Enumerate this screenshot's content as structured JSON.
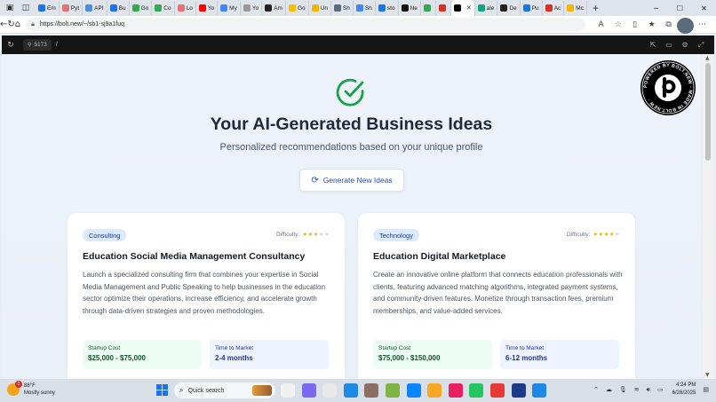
{
  "browser": {
    "tabs": [
      {
        "label": "Em",
        "color": "#1a73e8"
      },
      {
        "label": "Pyt",
        "color": "#e57373"
      },
      {
        "label": "API",
        "color": "#4a90d9"
      },
      {
        "label": "Bu",
        "color": "#1a73e8"
      },
      {
        "label": "Go",
        "color": "#34a853"
      },
      {
        "label": "Co",
        "color": "#34a853"
      },
      {
        "label": "Lo",
        "color": "#e57373"
      },
      {
        "label": "Yo",
        "color": "#ff0000"
      },
      {
        "label": "My",
        "color": "#4285f4"
      },
      {
        "label": "Yo",
        "color": "#999999"
      },
      {
        "label": "Am",
        "color": "#222222"
      },
      {
        "label": "Go",
        "color": "#fbbc05"
      },
      {
        "label": "Un",
        "color": "#f4b400"
      },
      {
        "label": "Sh",
        "color": "#5a6b7c"
      },
      {
        "label": "Sh",
        "color": "#4285f4"
      },
      {
        "label": "sto",
        "color": "#1a73e8"
      },
      {
        "label": "Ne",
        "color": "#111111"
      },
      {
        "label": "",
        "color": "#34a853"
      },
      {
        "label": "",
        "color": "#d93025"
      },
      {
        "label": "",
        "color": "#000000",
        "active": true
      },
      {
        "label": "ale",
        "color": "#10a37f"
      },
      {
        "label": "De",
        "color": "#222222"
      },
      {
        "label": "Pu",
        "color": "#1a73e8"
      },
      {
        "label": "Ac",
        "color": "#d93025"
      },
      {
        "label": "Mc",
        "color": "#f4b400"
      }
    ],
    "url": "https://bolt.new/~/sb1-sj9a1fuq"
  },
  "devbar": {
    "port": "5173",
    "path": "/"
  },
  "page": {
    "title": "Your AI-Generated Business Ideas",
    "subtitle": "Personalized recommendations based on your unique profile",
    "generate_button": "Generate New Ideas",
    "badge_text": "POWERED BY BOLT.NEW · MADE IN BOLT.NEW ·",
    "accent_color": "#16a34a",
    "cards": [
      {
        "tag": "Consulting",
        "difficulty_label": "Difficulty:",
        "difficulty_level": 3,
        "difficulty_max": 5,
        "title": "Education Social Media Management Consultancy",
        "description": "Launch a specialized consulting firm that combines your expertise in Social Media Management and Public Speaking to help businesses in the education sector optimize their operations, increase efficiency, and accelerate growth through data-driven strategies and proven methodologies.",
        "cost_label": "Startup Cost",
        "cost_value": "$25,000 - $75,000",
        "time_label": "Time to Market",
        "time_value": "2-4 months"
      },
      {
        "tag": "Technology",
        "difficulty_label": "Difficulty:",
        "difficulty_level": 4,
        "difficulty_max": 5,
        "title": "Education Digital Marketplace",
        "description": "Create an innovative online platform that connects education professionals with clients, featuring advanced matching algorithms, integrated payment systems, and community-driven features. Monetize through transaction fees, premium memberships, and value-added services.",
        "cost_label": "Startup Cost",
        "cost_value": "$75,000 - $150,000",
        "time_label": "Time to Market",
        "time_value": "6-12 months"
      }
    ]
  },
  "taskbar": {
    "weather_temp": "88°F",
    "weather_desc": "Mostly sunny",
    "weather_badge": "2",
    "search_placeholder": "Quick search",
    "time": "4:24 PM",
    "date": "6/28/2025",
    "apps": [
      "#f0f0f0",
      "#7b68ee",
      "#e8e8e8",
      "#1e88e5",
      "#8d6e63",
      "#7cb342",
      "#0a84ff",
      "#f9a825",
      "#e91e63",
      "#22c55e",
      "#e53935",
      "#1e3a8a",
      "#1e88e5"
    ]
  }
}
